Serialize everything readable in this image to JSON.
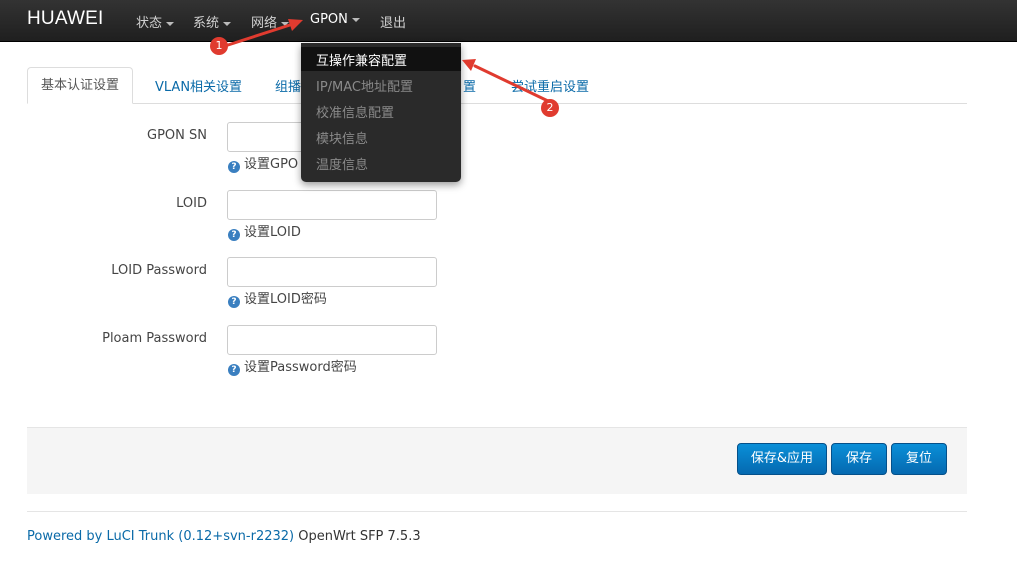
{
  "navbar": {
    "brand": "HUAWEI",
    "items": [
      {
        "label": "状态",
        "has_dropdown": true
      },
      {
        "label": "系统",
        "has_dropdown": true
      },
      {
        "label": "网络",
        "has_dropdown": true
      },
      {
        "label": "GPON",
        "has_dropdown": true,
        "active": true
      },
      {
        "label": "退出",
        "has_dropdown": false
      }
    ]
  },
  "gpon_menu": {
    "items": [
      "互操作兼容配置",
      "IP/MAC地址配置",
      "校准信息配置",
      "模块信息",
      "温度信息"
    ],
    "highlighted_index": 0
  },
  "tabs": {
    "items": [
      "基本认证设置",
      "VLAN相关设置",
      "组播",
      "置",
      "尝试重启设置"
    ],
    "active_index": 0
  },
  "form": {
    "fields": [
      {
        "label": "GPON SN",
        "value": "",
        "help": "设置GPO"
      },
      {
        "label": "LOID",
        "value": "",
        "help": "设置LOID"
      },
      {
        "label": "LOID Password",
        "value": "",
        "help": "设置LOID密码"
      },
      {
        "label": "Ploam Password",
        "value": "",
        "help": "设置Password密码"
      }
    ]
  },
  "actions": {
    "save_apply": "保存&应用",
    "save": "保存",
    "reset": "复位"
  },
  "footer": {
    "link_text": "Powered by LuCI Trunk (0.12+svn-r2232)",
    "version_text": "OpenWrt SFP 7.5.3"
  },
  "annotations": {
    "marker_1": "1",
    "marker_2": "2",
    "arrow_color": "#e03b2f"
  },
  "colors": {
    "navbar_bg": "#222222",
    "link": "#0a6aa8",
    "button": "#0a7fcc"
  }
}
